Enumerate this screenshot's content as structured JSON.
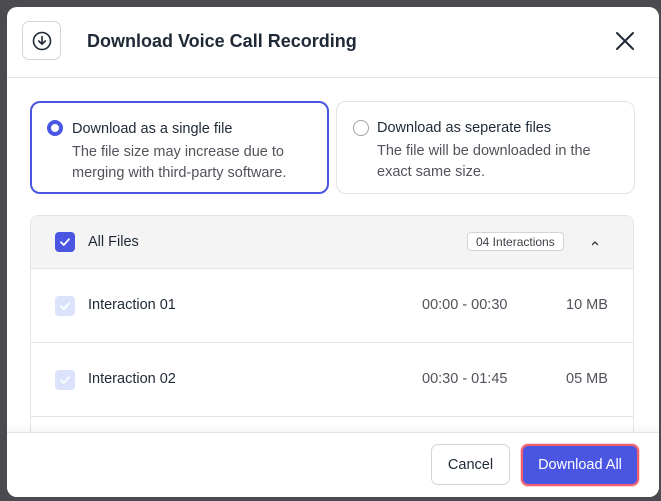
{
  "dialog": {
    "title": "Download Voice Call Recording",
    "header_icon": "download-circle-icon",
    "close_icon": "close-icon"
  },
  "options": [
    {
      "title": "Download as a single file",
      "description": "The file size may increase due to merging with third-party software.",
      "selected": true
    },
    {
      "title": "Download as seperate files",
      "description": "The file will be downloaded in the exact same size.",
      "selected": false
    }
  ],
  "files": {
    "all_label": "All Files",
    "badge": "04 Interactions",
    "all_checked": true,
    "rows": [
      {
        "name": "Interaction 01",
        "time": "00:00 - 00:30",
        "size": "10 MB",
        "checked": true
      },
      {
        "name": "Interaction 02",
        "time": "00:30 - 01:45",
        "size": "05 MB",
        "checked": true
      }
    ]
  },
  "footer": {
    "cancel_label": "Cancel",
    "download_label": "Download All"
  },
  "colors": {
    "accent": "#4a56e2",
    "focus_ring": "#f0616d",
    "backdrop": "#4a4a4f"
  }
}
